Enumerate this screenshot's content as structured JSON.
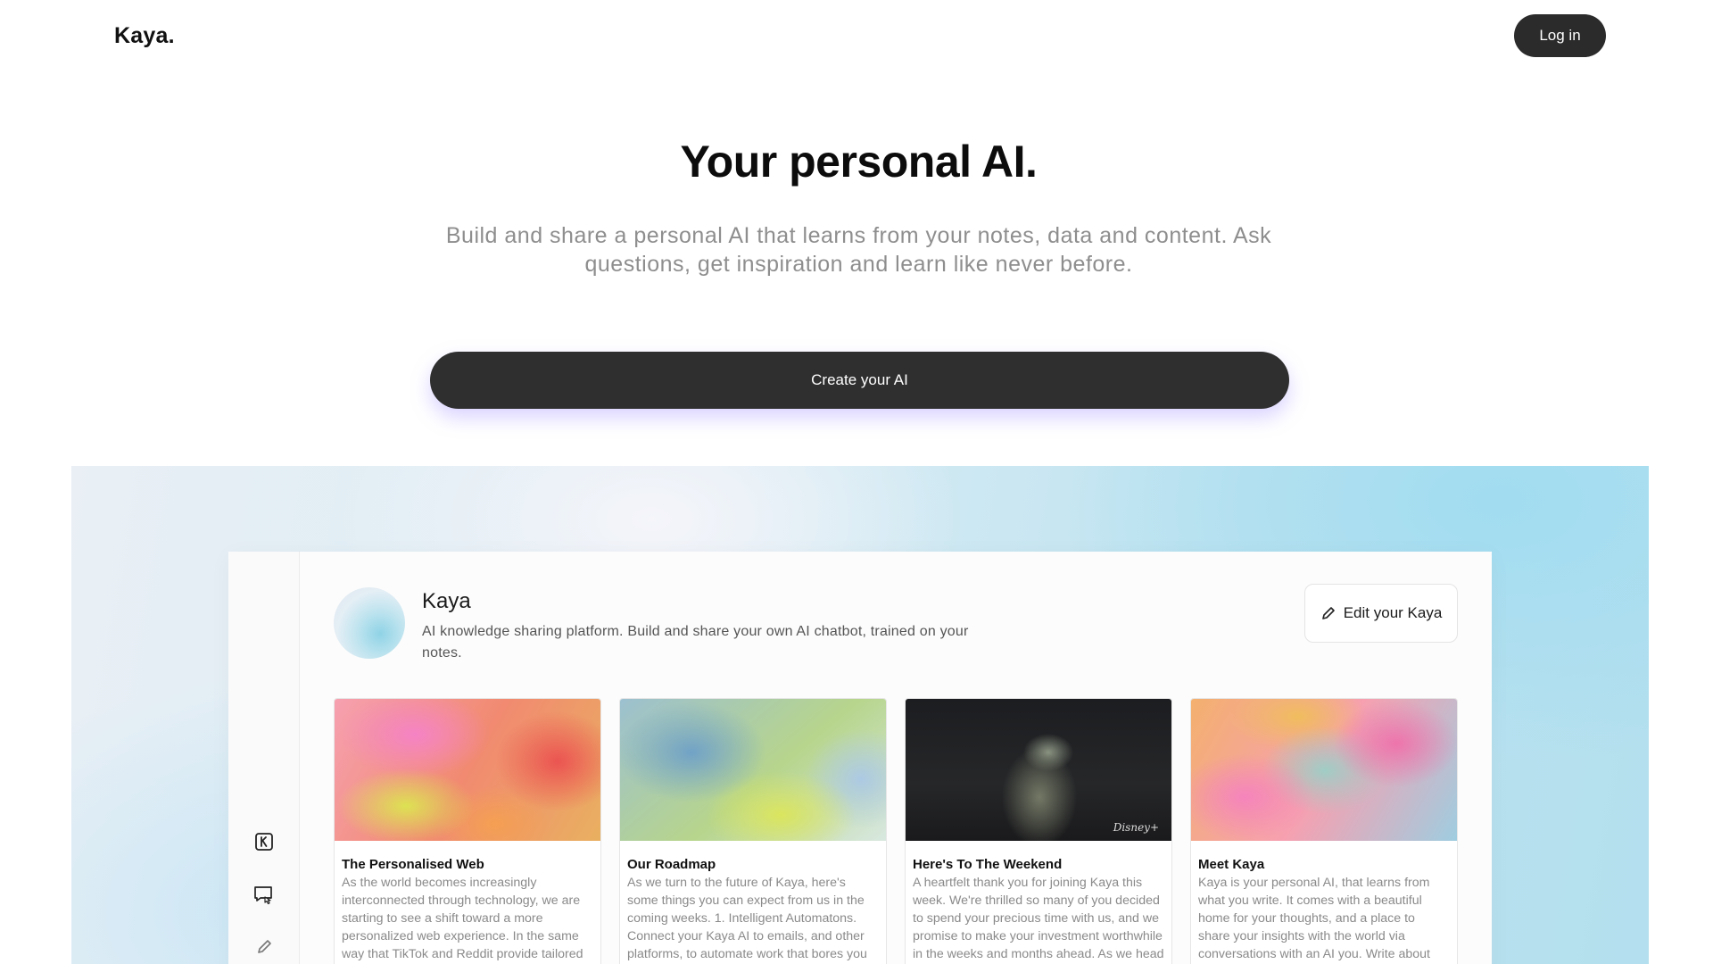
{
  "header": {
    "logo": "Kaya.",
    "login_label": "Log in"
  },
  "hero": {
    "title": "Your personal AI.",
    "subtitle": "Build and share a personal AI that learns from your notes, data and content. Ask questions, get inspiration and learn like never before.",
    "cta_label": "Create your AI"
  },
  "preview": {
    "rail_icons": [
      "kaya-logo-icon",
      "chat-icon",
      "edit-pencil-icon"
    ],
    "profile": {
      "name": "Kaya",
      "description": "AI knowledge sharing platform. Build and share your own AI chatbot, trained on your notes."
    },
    "edit_button_label": "Edit your Kaya",
    "cards": [
      {
        "title": "The Personalised Web",
        "text": "As the world becomes increasingly interconnected through technology, we are starting to see a shift toward a more personalized web experience. In the same way that TikTok and Reddit provide tailored content to users, artificial"
      },
      {
        "title": "Our Roadmap",
        "text": "As we turn to the future of Kaya, here's some things you can expect from us in the coming weeks. 1. Intelligent Automatons. Connect your Kaya AI to emails, and other platforms, to automate work that bores you and free you up to"
      },
      {
        "title": "Here's To The Weekend",
        "text": "A heartfelt thank you for joining Kaya this week. We're thrilled so many of you decided to spend your precious time with us, and we promise to make your investment worthwhile in the weeks and months ahead. As we head into the",
        "image_brand": "Disney+"
      },
      {
        "title": "Meet Kaya",
        "text": "Kaya is your personal AI, that learns from what you write. It comes with a beautiful home for your thoughts, and a place to share your insights with the world via conversations with an AI you. Write about anything - from short musings to detail"
      }
    ]
  }
}
